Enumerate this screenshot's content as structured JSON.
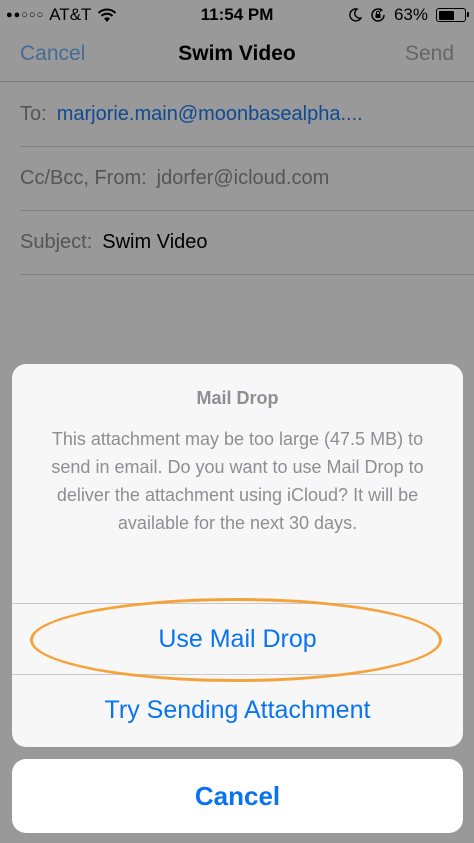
{
  "status_bar": {
    "signal": "●●○○○",
    "carrier": "AT&T",
    "time": "11:54 PM",
    "battery": "63%",
    "battery_level": 0.63,
    "icons": [
      "wifi-icon",
      "moon-icon",
      "rotation-lock-icon",
      "battery-icon"
    ]
  },
  "nav": {
    "cancel": "Cancel",
    "title": "Swim Video",
    "send": "Send"
  },
  "fields": {
    "to_label": "To:",
    "to_value": "marjorie.main@moonbasealpha....",
    "ccbcc_label": "Cc/Bcc, From:",
    "ccbcc_value": "jdorfer@icloud.com",
    "subject_label": "Subject:",
    "subject_value": "Swim Video"
  },
  "action_sheet": {
    "title": "Mail Drop",
    "message": "This attachment may be too large (47.5 MB) to send in email. Do you want to use Mail Drop to deliver the attachment using iCloud? It will be available for the next 30 days.",
    "use_mail_drop": "Use Mail Drop",
    "try_sending": "Try Sending Attachment",
    "cancel": "Cancel"
  },
  "colors": {
    "accent": "#0a74f0",
    "highlight": "#f5a23a"
  }
}
